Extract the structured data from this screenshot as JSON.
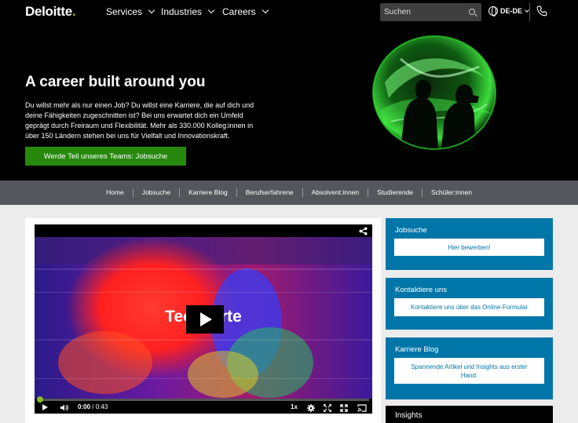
{
  "nav": {
    "logo_text": "Deloitte",
    "logo_dot": ".",
    "items": [
      {
        "label": "Services"
      },
      {
        "label": "Industries"
      },
      {
        "label": "Careers"
      }
    ],
    "search_placeholder": "Suchen",
    "language": "DE-DE"
  },
  "hero": {
    "title": "A career built around you",
    "text": "Du willst mehr als nur einen Job? Du willst eine Karriere, die auf dich und deine Fähigkeiten zugeschnitten ist? Bei uns erwartet dich ein Umfeld geprägt durch Freiraum und Flexibilität. Mehr als 330.000 Kolleg:innen in über 150 Ländern stehen bei uns für Vielfalt und Innovationskraft.",
    "cta": "Werde Teil unseres Teams: Jobsuche"
  },
  "subnav": {
    "items": [
      "Home",
      "Jobsuche",
      "Karriere Blog",
      "Berufserfahrene",
      "Absolvent:innen",
      "Studierende",
      "Schüler:innen"
    ]
  },
  "video": {
    "title": "Tech  erte",
    "current_time": "0:00",
    "duration": "/ 0:43",
    "speed": "1x",
    "progress": 0
  },
  "sidebar": {
    "boxes": [
      {
        "title": "Jobsuche",
        "button": "Hier bewerben!"
      },
      {
        "title": "Kontaktiere uns",
        "button": "Kontaktiere uns über das Online-Formular"
      },
      {
        "title": "Karriere Blog",
        "button": "Spannende Artikel und Insights aus erster Hand."
      }
    ],
    "insights_title": "Insights"
  },
  "colors": {
    "brand_green": "#86bc25",
    "cta_green": "#26890d",
    "side_blue": "#0076a8",
    "subnav_gray": "#53565a"
  }
}
